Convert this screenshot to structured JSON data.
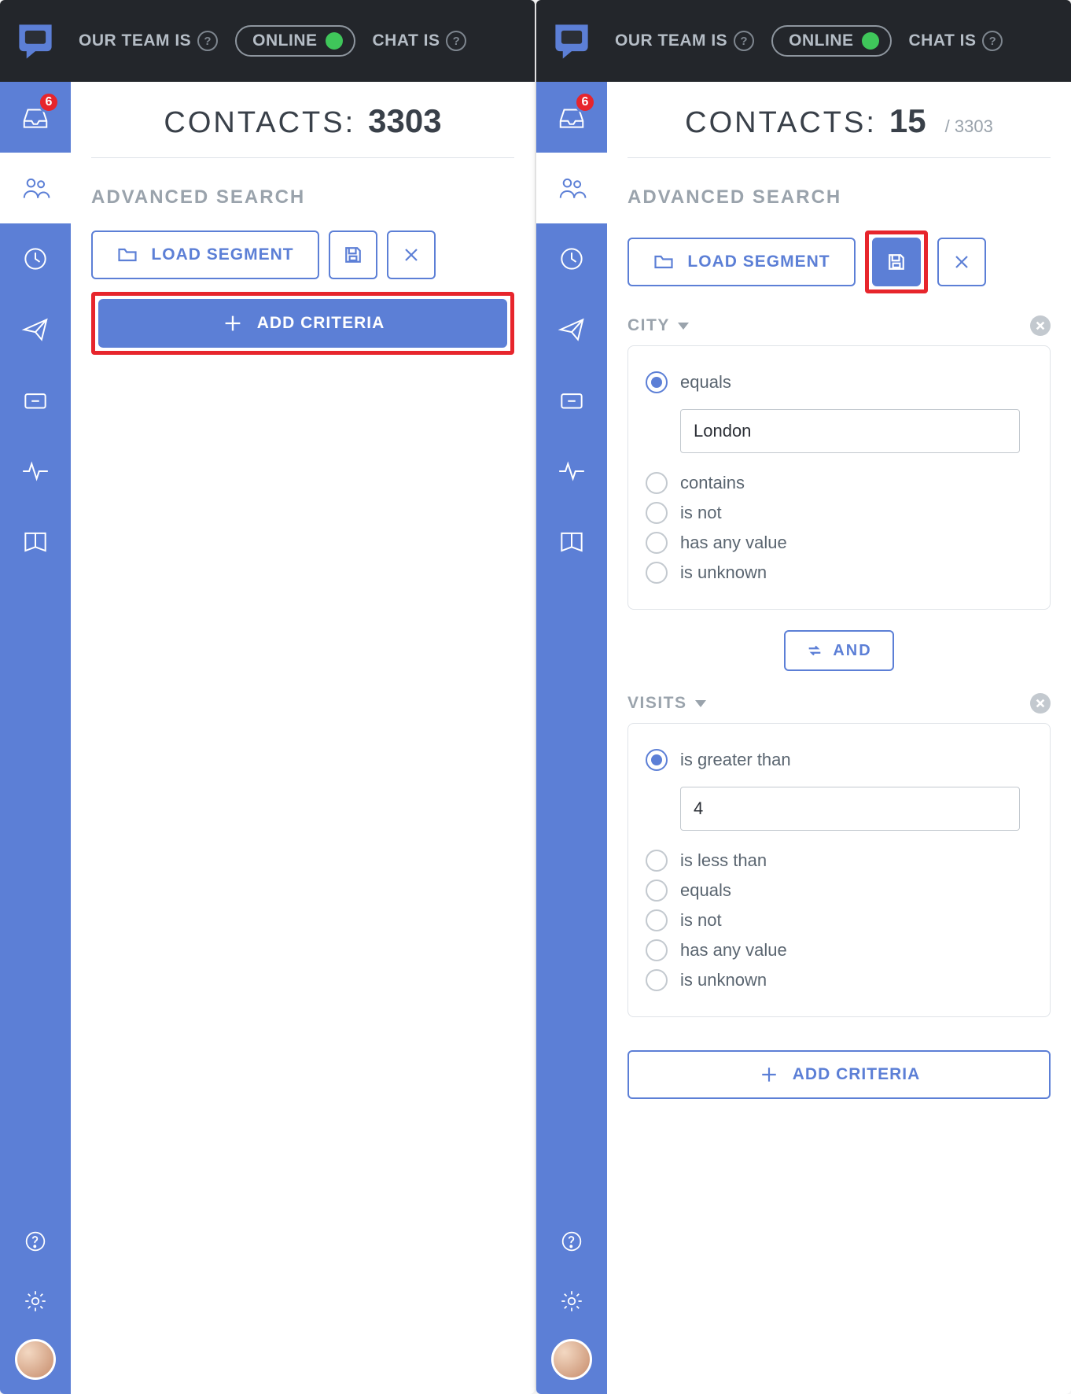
{
  "topbar": {
    "team_label": "OUR TEAM IS",
    "online_label": "ONLINE",
    "chat_label": "CHAT IS"
  },
  "sidebar": {
    "inbox_badge": "6"
  },
  "left": {
    "contacts_label": "CONTACTS:",
    "contacts_count": "3303",
    "section_title": "ADVANCED SEARCH",
    "load_segment": "LOAD SEGMENT",
    "add_criteria": "ADD CRITERIA"
  },
  "right": {
    "contacts_label": "CONTACTS:",
    "contacts_count": "15",
    "contacts_total": "/ 3303",
    "section_title": "ADVANCED SEARCH",
    "load_segment": "LOAD SEGMENT",
    "and_label": "AND",
    "add_criteria": "ADD CRITERIA",
    "criteria": [
      {
        "key": "city",
        "label": "CITY",
        "options": [
          "equals",
          "contains",
          "is not",
          "has any value",
          "is unknown"
        ],
        "selected": "equals",
        "value": "London"
      },
      {
        "key": "visits",
        "label": "VISITS",
        "options": [
          "is greater than",
          "is less than",
          "equals",
          "is not",
          "has any value",
          "is unknown"
        ],
        "selected": "is greater than",
        "value": "4"
      }
    ]
  }
}
